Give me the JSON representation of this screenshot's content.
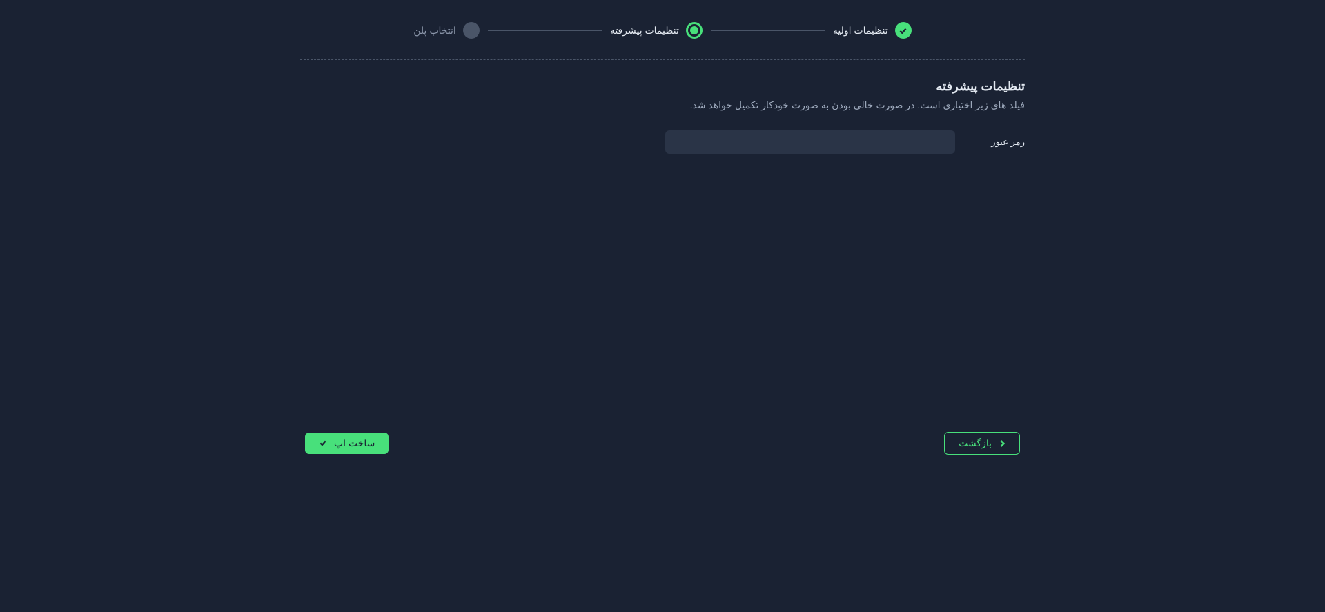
{
  "stepper": {
    "steps": [
      {
        "label": "تنظیمات اولیه",
        "state": "completed"
      },
      {
        "label": "تنظیمات پیشرفته",
        "state": "active"
      },
      {
        "label": "انتخاب پلن",
        "state": "pending"
      }
    ]
  },
  "section": {
    "title": "تنظیمات پیشرفته",
    "description": "فیلد های زیر اختیاری است. در صورت خالی بودن به صورت خودکار تکمیل خواهد شد."
  },
  "form": {
    "password_label": "رمز عبور",
    "password_value": ""
  },
  "footer": {
    "back_label": "بازگشت",
    "submit_label": "ساخت اپ"
  }
}
